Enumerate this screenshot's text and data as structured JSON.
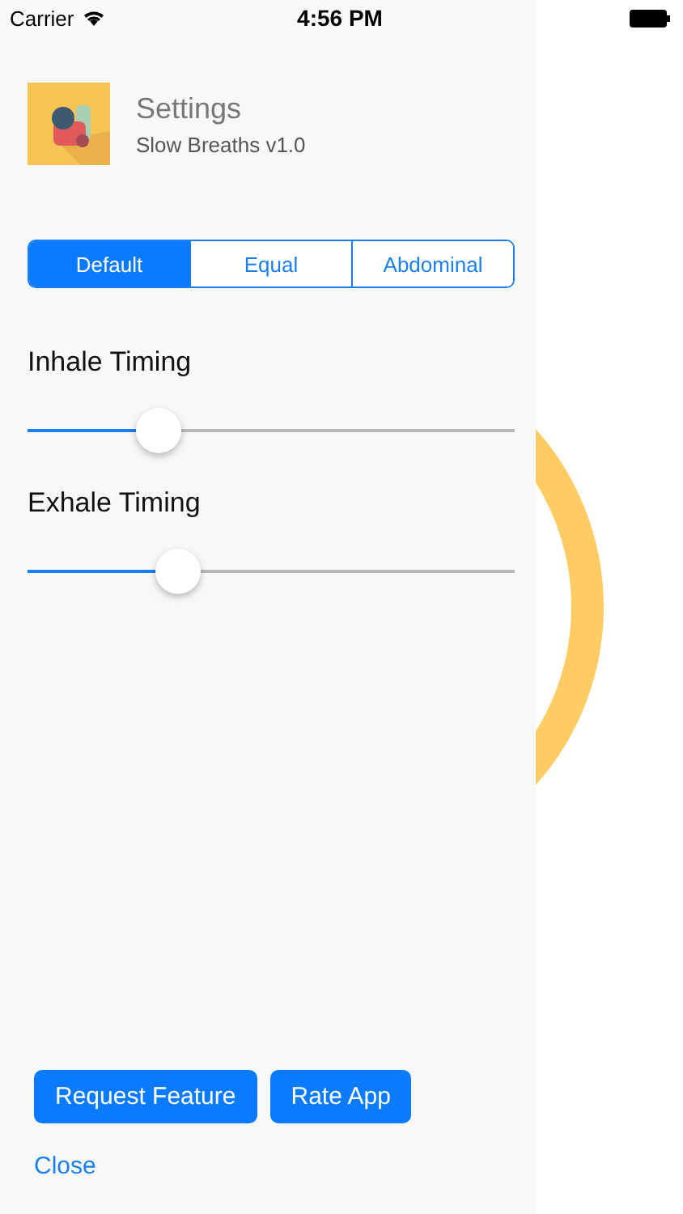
{
  "status_bar": {
    "carrier": "Carrier",
    "time": "4:56 PM"
  },
  "header": {
    "title": "Settings",
    "subtitle": "Slow Breaths v1.0"
  },
  "segments": [
    {
      "label": "Default",
      "selected": true
    },
    {
      "label": "Equal",
      "selected": false
    },
    {
      "label": "Abdominal",
      "selected": false
    }
  ],
  "sliders": [
    {
      "label": "Inhale Timing",
      "level": 0.27
    },
    {
      "label": "Exhale Timing",
      "level": 0.31
    }
  ],
  "buttons": [
    "Request Feature",
    "Rate App"
  ],
  "close": "Close"
}
